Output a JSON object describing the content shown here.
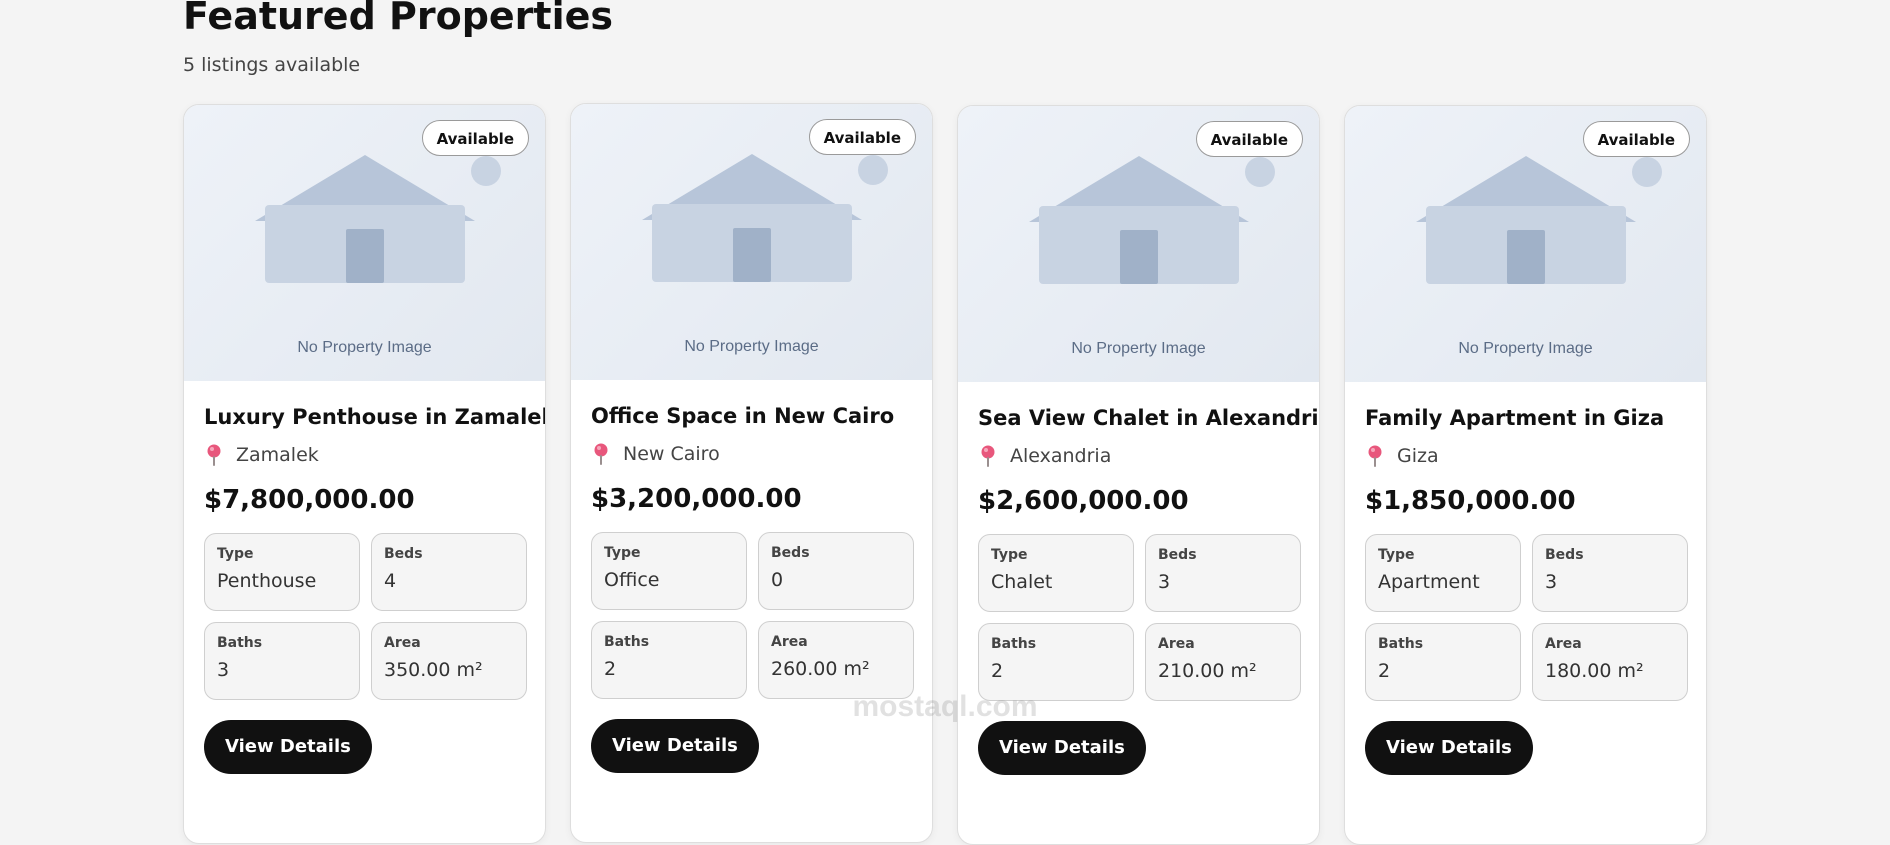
{
  "header": {
    "title": "Featured Properties",
    "subtitle": "5 listings available"
  },
  "colors": {
    "background": "#f4f4f4",
    "button": "#111111",
    "pin": "#e8577c",
    "placeholder": "#c8d3e2"
  },
  "cards": [
    {
      "status": "Available",
      "no_image_text": "No Property Image",
      "title": "Luxury Penthouse in Zamalek",
      "location": "Zamalek",
      "price": "$7,800,000.00",
      "specs": [
        {
          "label": "Type",
          "value": "Penthouse"
        },
        {
          "label": "Beds",
          "value": "4"
        },
        {
          "label": "Baths",
          "value": "3"
        },
        {
          "label": "Area",
          "value": "350.00 m²"
        }
      ],
      "button": "View Details"
    },
    {
      "status": "Available",
      "no_image_text": "No Property Image",
      "title": "Office Space in New Cairo",
      "location": "New Cairo",
      "price": "$3,200,000.00",
      "specs": [
        {
          "label": "Type",
          "value": "Office"
        },
        {
          "label": "Beds",
          "value": "0"
        },
        {
          "label": "Baths",
          "value": "2"
        },
        {
          "label": "Area",
          "value": "260.00 m²"
        }
      ],
      "button": "View Details"
    },
    {
      "status": "Available",
      "no_image_text": "No Property Image",
      "title": "Sea View Chalet in Alexandria",
      "location": "Alexandria",
      "price": "$2,600,000.00",
      "specs": [
        {
          "label": "Type",
          "value": "Chalet"
        },
        {
          "label": "Beds",
          "value": "3"
        },
        {
          "label": "Baths",
          "value": "2"
        },
        {
          "label": "Area",
          "value": "210.00 m²"
        }
      ],
      "button": "View Details"
    },
    {
      "status": "Available",
      "no_image_text": "No Property Image",
      "title": "Family Apartment in Giza",
      "location": "Giza",
      "price": "$1,850,000.00",
      "specs": [
        {
          "label": "Type",
          "value": "Apartment"
        },
        {
          "label": "Beds",
          "value": "3"
        },
        {
          "label": "Baths",
          "value": "2"
        },
        {
          "label": "Area",
          "value": "180.00 m²"
        }
      ],
      "button": "View Details"
    }
  ],
  "watermark": {
    "text": "mostaql.com"
  }
}
